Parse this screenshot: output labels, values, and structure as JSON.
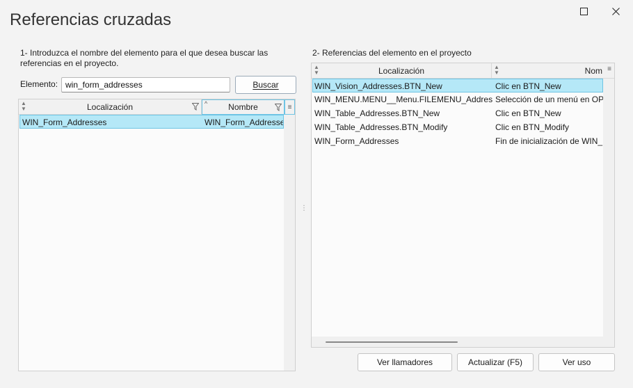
{
  "window": {
    "title": "Referencias cruzadas",
    "maximize_icon": "maximize-icon",
    "close_icon": "close-icon"
  },
  "left": {
    "instruction": "1- Introduzca el nombre del elemento para el que desea buscar las referencias en el proyecto.",
    "instruction_line1": "1- Introduzca el nombre del elemento para el que desea buscar las",
    "instruction_line2": "referencias en el proyecto.",
    "element_label": "Elemento:",
    "element_value": "win_form_addresses",
    "search_button": "Buscar",
    "columns": [
      "Localización",
      "Nombre"
    ],
    "rows": [
      {
        "location": "WIN_Form_Addresses",
        "name": "WIN_Form_Addresses"
      }
    ]
  },
  "right": {
    "instruction": "2- Referencias del elemento en el proyecto",
    "columns": [
      "Localización",
      "Nom"
    ],
    "rows": [
      {
        "location": "WIN_Vision_Addresses.BTN_New",
        "name": "Clic en BTN_New"
      },
      {
        "location": "WIN_MENU.MENU__Menu.FILEMENU_Addresses",
        "name": "Selección de un menú en OPT"
      },
      {
        "location": "WIN_Table_Addresses.BTN_New",
        "name": "Clic en BTN_New"
      },
      {
        "location": "WIN_Table_Addresses.BTN_Modify",
        "name": "Clic en BTN_Modify"
      },
      {
        "location": "WIN_Form_Addresses",
        "name": "Fin de inicialización de WIN_F"
      }
    ]
  },
  "footer": {
    "callers_button": "Ver llamadores",
    "refresh_button": "Actualizar (F5)",
    "usage_button": "Ver uso"
  },
  "colors": {
    "selection": "#b5e8f7",
    "selection_border": "#6ec4e4",
    "background": "#f3f3f3"
  }
}
